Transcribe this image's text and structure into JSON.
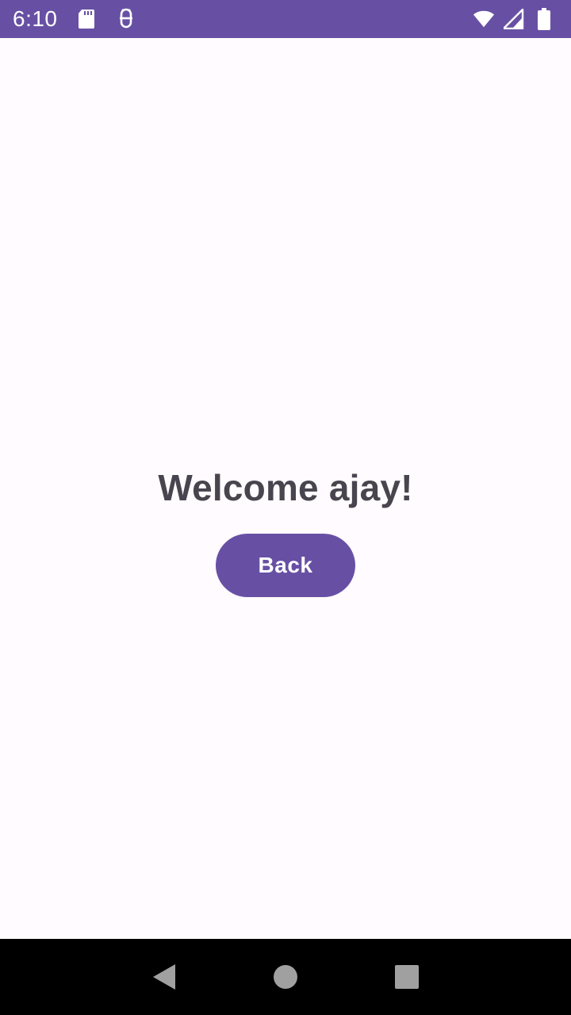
{
  "status_bar": {
    "time": "6:10",
    "icons_left": [
      "sd-card-icon",
      "debug-icon"
    ],
    "icons_right": [
      "wifi-icon",
      "cell-signal-icon",
      "battery-icon"
    ],
    "background": "#6750a4"
  },
  "main": {
    "welcome_text": "Welcome ajay!",
    "back_label": "Back",
    "accent": "#6750a4",
    "text_color": "#48454e"
  },
  "nav_bar": {
    "buttons": [
      "back-nav-icon",
      "home-nav-icon",
      "recents-nav-icon"
    ]
  }
}
